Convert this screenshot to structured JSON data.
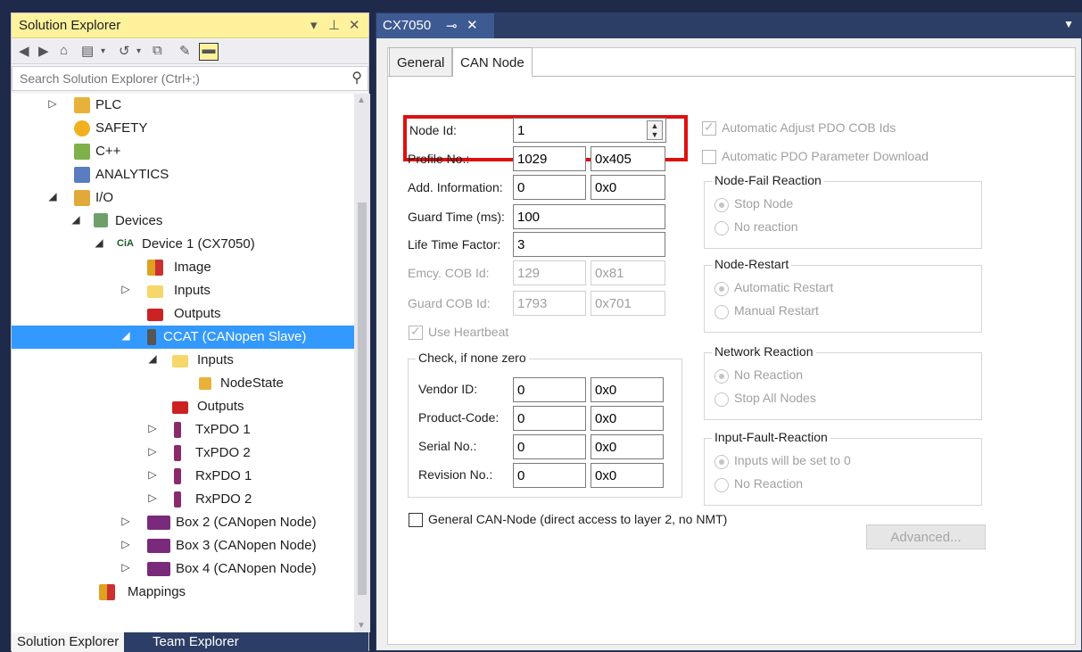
{
  "solution_explorer": {
    "title": "Solution Explorer",
    "title_controls": [
      "▾",
      "⊥",
      "✕"
    ],
    "search_placeholder": "Search Solution Explorer (Ctrl+;)",
    "tree": [
      {
        "label": "PLC",
        "icon": "plc-icon",
        "expand": "▷"
      },
      {
        "label": "SAFETY",
        "icon": "safety-icon",
        "expand": ""
      },
      {
        "label": "C++",
        "icon": "cpp-icon",
        "expand": ""
      },
      {
        "label": "ANALYTICS",
        "icon": "analytics-icon",
        "expand": ""
      },
      {
        "label": "I/O",
        "icon": "io-icon",
        "expand": "◢"
      },
      {
        "label": "Devices",
        "icon": "devices-icon",
        "expand": "◢"
      },
      {
        "label": "Device 1 (CX7050)",
        "icon": "cia-icon",
        "expand": "◢"
      },
      {
        "label": "Image",
        "icon": "image-icon",
        "expand": ""
      },
      {
        "label": "Inputs",
        "icon": "inputs-folder-icon",
        "expand": "▷"
      },
      {
        "label": "Outputs",
        "icon": "outputs-icon",
        "expand": ""
      },
      {
        "label": "CCAT (CANopen Slave)",
        "icon": "ccat-icon",
        "expand": "◢"
      },
      {
        "label": "Inputs",
        "icon": "inputs-folder-icon",
        "expand": "◢"
      },
      {
        "label": "NodeState",
        "icon": "variable-icon",
        "expand": ""
      },
      {
        "label": "Outputs",
        "icon": "outputs-icon",
        "expand": ""
      },
      {
        "label": "TxPDO 1",
        "icon": "txpdo-icon",
        "expand": "▷"
      },
      {
        "label": "TxPDO 2",
        "icon": "txpdo-icon",
        "expand": "▷"
      },
      {
        "label": "RxPDO 1",
        "icon": "rxpdo-icon",
        "expand": "▷"
      },
      {
        "label": "RxPDO 2",
        "icon": "rxpdo-icon",
        "expand": "▷"
      },
      {
        "label": "Box 2 (CANopen Node)",
        "icon": "box-icon",
        "expand": "▷"
      },
      {
        "label": "Box 3 (CANopen Node)",
        "icon": "box-icon",
        "expand": "▷"
      },
      {
        "label": "Box 4 (CANopen Node)",
        "icon": "box-icon",
        "expand": "▷"
      },
      {
        "label": "Mappings",
        "icon": "mappings-icon",
        "expand": ""
      }
    ],
    "bottom_tabs": [
      "Solution Explorer",
      "Team Explorer"
    ]
  },
  "document": {
    "tab_title": "CX7050",
    "tabs": [
      "General",
      "CAN Node"
    ],
    "fields": {
      "node_id_label": "Node Id:",
      "node_id": "1",
      "profile_label": "Profile No.:",
      "profile_dec": "1029",
      "profile_hex": "0x405",
      "addinfo_label": "Add. Information:",
      "addinfo_dec": "0",
      "addinfo_hex": "0x0",
      "guard_time_label": "Guard Time (ms):",
      "guard_time": "100",
      "life_time_label": "Life Time Factor:",
      "life_time": "3",
      "emcy_label": "Emcy. COB Id:",
      "emcy_dec": "129",
      "emcy_hex": "0x81",
      "guard_cob_label": "Guard COB Id:",
      "guard_cob_dec": "1793",
      "guard_cob_hex": "0x701",
      "heartbeat_label": "Use Heartbeat"
    },
    "check_group": {
      "caption": "Check, if none zero",
      "vendor_label": "Vendor ID:",
      "vendor_dec": "0",
      "vendor_hex": "0x0",
      "product_label": "Product-Code:",
      "product_dec": "0",
      "product_hex": "0x0",
      "serial_label": "Serial No.:",
      "serial_dec": "0",
      "serial_hex": "0x0",
      "revision_label": "Revision No.:",
      "revision_dec": "0",
      "revision_hex": "0x0"
    },
    "right": {
      "auto_adjust": "Automatic Adjust PDO COB Ids",
      "auto_download": "Automatic PDO Parameter Download",
      "node_fail": {
        "caption": "Node-Fail Reaction",
        "opt1": "Stop Node",
        "opt2": "No reaction"
      },
      "node_restart": {
        "caption": "Node-Restart",
        "opt1": "Automatic Restart",
        "opt2": "Manual Restart"
      },
      "network": {
        "caption": "Network Reaction",
        "opt1": "No Reaction",
        "opt2": "Stop All Nodes"
      },
      "input_fault": {
        "caption": "Input-Fault-Reaction",
        "opt1": "Inputs will be set to 0",
        "opt2": "No Reaction"
      }
    },
    "general_can_node": "General CAN-Node (direct access to layer 2, no NMT)",
    "advanced_button": "Advanced..."
  },
  "colors": {
    "highlight": "#dd1010",
    "selection": "#3399ff",
    "title_yellow": "#fff29d",
    "chrome": "#2d3e66"
  }
}
